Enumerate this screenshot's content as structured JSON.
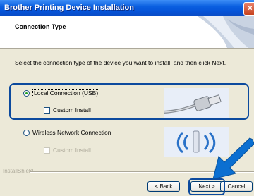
{
  "window": {
    "title": "Brother Printing Device Installation",
    "close_glyph": "×"
  },
  "header": {
    "section_title": "Connection Type"
  },
  "instruction": "Select the connection type of the device you want to install, and then click Next.",
  "options": {
    "local": {
      "label": "Local Connection (USB)",
      "selected": true
    },
    "custom_local": {
      "label": "Custom Install",
      "checked": false
    },
    "wireless": {
      "label": "Wireless Network Connection",
      "selected": false
    },
    "custom_wireless": {
      "label": "Custom Install",
      "enabled": false
    }
  },
  "branding": "InstallShield",
  "buttons": {
    "back": "< Back",
    "next": "Next >",
    "cancel": "Cancel"
  },
  "colors": {
    "highlight": "#0c4a9e",
    "arrow": "#0b6fd1"
  }
}
